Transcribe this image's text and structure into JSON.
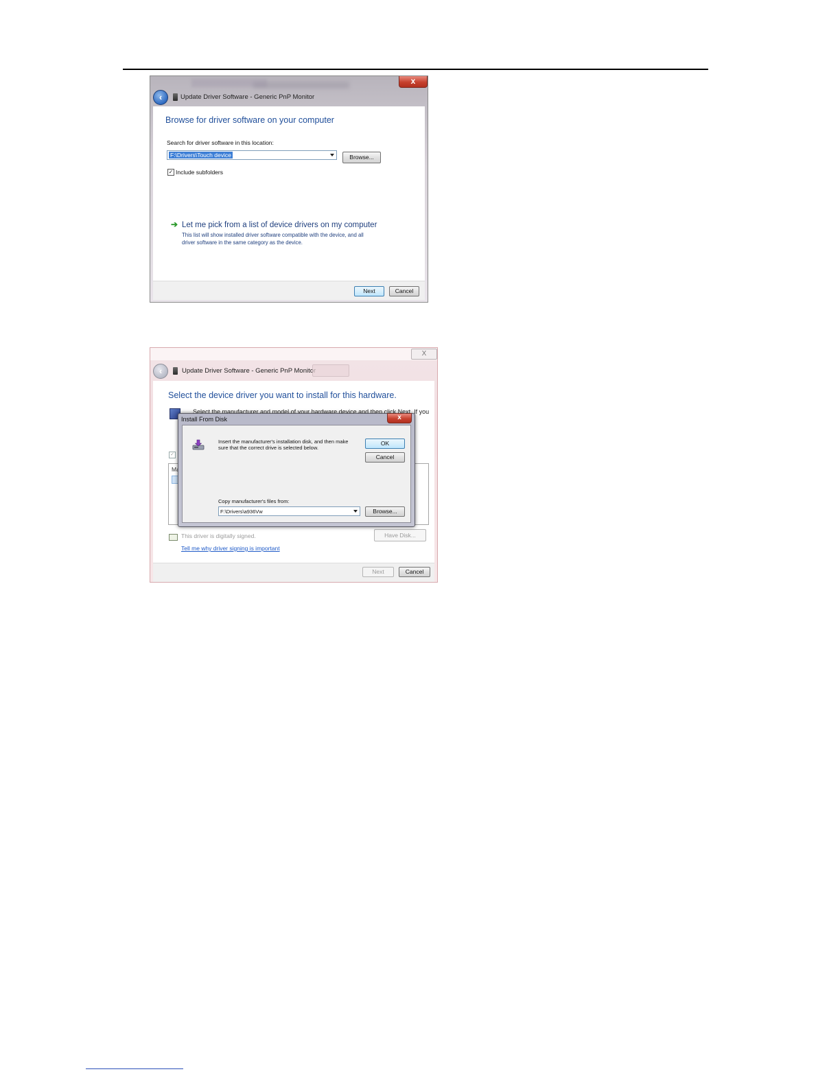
{
  "screenshot1": {
    "window_title": "Update Driver Software - Generic PnP Monitor",
    "close_glyph": "x",
    "heading": "Browse for driver software on your computer",
    "search_label": "Search for driver software in this location:",
    "path_value": "F:\\Drivers\\Touch device",
    "browse_label": "Browse...",
    "include_subfolders_label": "Include subfolders",
    "include_subfolders_checked": true,
    "check_glyph": "✓",
    "pick_link_title": "Let me pick from a list of device drivers on my computer",
    "pick_link_desc_line1": "This list will show installed driver software compatible with the device, and all",
    "pick_link_desc_line2": "driver software in the same category as the device.",
    "next_label": "Next",
    "cancel_label": "Cancel",
    "arrow_glyph": "➔"
  },
  "screenshot2": {
    "window_title": "Update Driver Software - Generic PnP Monitor",
    "close_glyph": "X",
    "heading": "Select the device driver you want to install for this hardware.",
    "behind_text": "Select the manufacturer and model of your hardware device and then click Next. If you",
    "list_label_fragment": "Ma",
    "signed_text": "This driver is digitally signed.",
    "signing_link": "Tell me why driver signing is important",
    "have_disk_label": "Have Disk...",
    "next_label": "Next",
    "cancel_label": "Cancel",
    "install_from_disk": {
      "title": "Install From Disk",
      "close_glyph": "x",
      "message": "Insert the manufacturer's installation disk, and then make sure that the correct drive is selected below.",
      "ok_label": "OK",
      "cancel_label": "Cancel",
      "copy_label": "Copy manufacturer's files from:",
      "path_value": "F:\\Drivers\\a936Vw",
      "browse_label": "Browse..."
    }
  }
}
